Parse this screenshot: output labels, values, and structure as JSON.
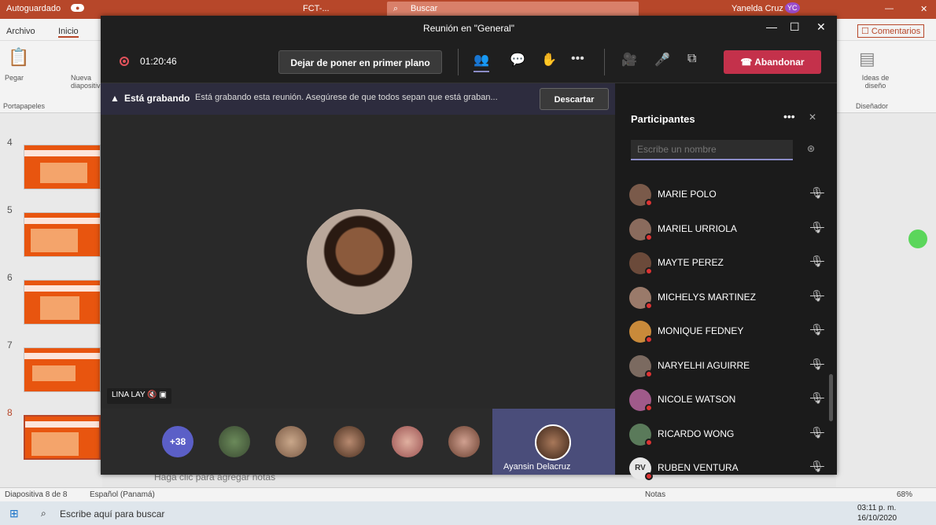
{
  "ppt": {
    "autosave": "Autoguardado",
    "toggle": "●",
    "title": "FCT-...",
    "search": "Buscar",
    "user": "Yanelda Cruz",
    "user_initials": "YC",
    "tabs": [
      "Archivo",
      "Inicio"
    ],
    "comments": "Comentarios",
    "paste": "Pegar",
    "new_slide": "Nueva diapositiva",
    "clipboard": "Portapapeles",
    "ideas": "Ideas de diseño",
    "designer": "Diseñador",
    "slide_numbers": [
      "4",
      "5",
      "6",
      "7",
      "8"
    ],
    "notes_placeholder": "Haga clic para agregar notas",
    "status_slide": "Diapositiva 8 de 8",
    "status_lang": "Español (Panamá)",
    "notes": "Notas",
    "zoom": "68%"
  },
  "taskbar": {
    "search_placeholder": "Escribe aquí para buscar",
    "time": "03:11 p. m.",
    "date": "16/10/2020"
  },
  "teams": {
    "window_title": "Reunión en \"General\"",
    "timer": "01:20:46",
    "unspotlight": "Dejar de poner en primer plano",
    "leave": "Abandonar",
    "recording_strong": "Está grabando",
    "recording_text": "Está grabando esta reunión. Asegúrese de que todos sepan que está graban...",
    "dismiss": "Descartar",
    "spotlight_name": "LINA LAY",
    "more_count": "+38",
    "featured_name": "Ayansin Delacruz",
    "panel_title": "Participantes",
    "search_placeholder": "Escribe un nombre",
    "participants": [
      {
        "name": "MARIE POLO",
        "color": "#7a5a4a"
      },
      {
        "name": "MARIEL URRIOLA",
        "color": "#8a6b5d"
      },
      {
        "name": "MAYTE PEREZ",
        "color": "#6b4a3a"
      },
      {
        "name": "MICHELYS MARTINEZ",
        "color": "#9a7a6a"
      },
      {
        "name": "MONIQUE FEDNEY",
        "color": "#c98a3a"
      },
      {
        "name": "NARYELHI AGUIRRE",
        "color": "#7b6a60"
      },
      {
        "name": "NICOLE WATSON",
        "color": "#a05a8a"
      },
      {
        "name": "RICARDO WONG",
        "color": "#5a7a5a"
      },
      {
        "name": "RUBEN VENTURA",
        "color": "#e8e8e8",
        "initials": "RV"
      }
    ]
  }
}
